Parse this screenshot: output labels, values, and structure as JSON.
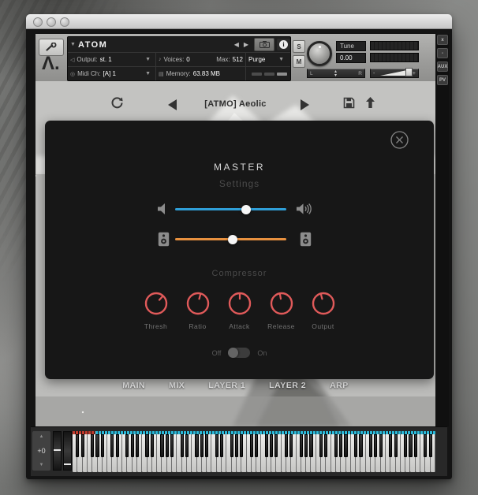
{
  "window": {
    "buttons": [
      "close",
      "minimize",
      "zoom"
    ]
  },
  "header": {
    "title": "ATOM",
    "output_label": "Output:",
    "output_value": "st. 1",
    "midi_label": "Midi Ch:",
    "midi_value": "[A] 1",
    "voices_label": "Voices:",
    "voices_value": "0",
    "max_label": "Max:",
    "max_value": "512",
    "memory_label": "Memory:",
    "memory_value": "63.83 MB",
    "purge_label": "Purge",
    "solo_label": "S",
    "mute_label": "M",
    "tune_label": "Tune",
    "tune_value": "0.00",
    "pan_left": "L",
    "pan_right": "R",
    "vol_minus": "-",
    "vol_plus": "+",
    "side_buttons": [
      "x",
      "-",
      "AUX",
      "PV"
    ]
  },
  "preset_bar": {
    "name": "[ATMO] Aeolic"
  },
  "master_panel": {
    "title": "MASTER",
    "subtitle": "Settings",
    "sliders": [
      {
        "name": "volume",
        "color": "#2f9fd8",
        "value_pct": 64
      },
      {
        "name": "width",
        "color": "#e8913f",
        "value_pct": 52
      }
    ],
    "compressor": {
      "label": "Compressor",
      "knobs": [
        {
          "label": "Thresh",
          "angle_deg": 42
        },
        {
          "label": "Ratio",
          "angle_deg": 15
        },
        {
          "label": "Attack",
          "angle_deg": 0
        },
        {
          "label": "Release",
          "angle_deg": -10
        },
        {
          "label": "Output",
          "angle_deg": -15
        }
      ],
      "toggle": {
        "off_label": "Off",
        "on_label": "On",
        "state": "off"
      }
    }
  },
  "tabs": [
    {
      "label": "MAIN"
    },
    {
      "label": "MIX"
    },
    {
      "label": "LAYER 1"
    },
    {
      "label": "LAYER 2"
    },
    {
      "label": "ARP"
    }
  ],
  "keyboard": {
    "transpose_value": "+0",
    "white_keys": 73,
    "red_marker_fraction": 0.063,
    "marker_red": "#c0392b",
    "marker_cyan": "#29b8d8",
    "pitch_wheel_pos_pct": 46,
    "mod_wheel_pos_pct": 84
  },
  "colors": {
    "knob_red": "#e05a5a"
  }
}
